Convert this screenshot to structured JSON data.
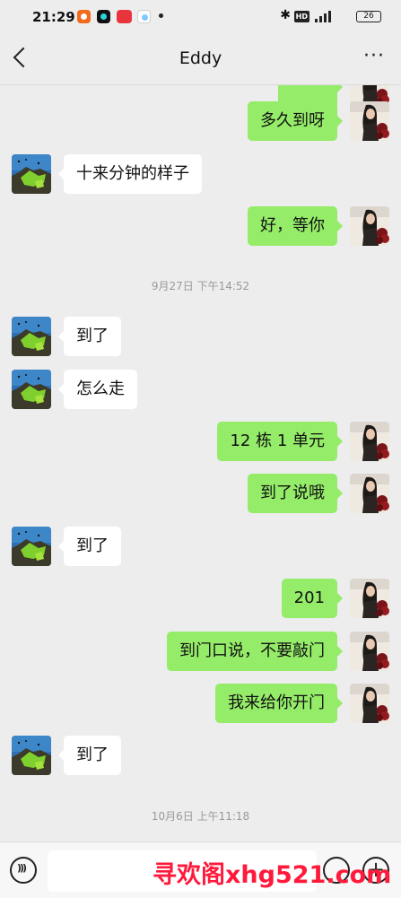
{
  "status_bar": {
    "time": "21:29",
    "battery": "26",
    "hd": "HD"
  },
  "header": {
    "title": "Eddy",
    "more": "···"
  },
  "messages": [
    {
      "side": "right",
      "text": "多久到呀"
    },
    {
      "side": "left",
      "text": "十来分钟的样子"
    },
    {
      "side": "right",
      "text": "好，等你"
    },
    {
      "side": "time",
      "text": "9月27日 下午14:52"
    },
    {
      "side": "left",
      "text": "到了"
    },
    {
      "side": "left",
      "text": "怎么走"
    },
    {
      "side": "right",
      "text": "12 栋 1 单元"
    },
    {
      "side": "right",
      "text": "到了说哦"
    },
    {
      "side": "left",
      "text": "到了"
    },
    {
      "side": "right",
      "text": "201"
    },
    {
      "side": "right",
      "text": "到门口说，不要敲门"
    },
    {
      "side": "right",
      "text": "我来给你开门"
    },
    {
      "side": "left",
      "text": "到了"
    },
    {
      "side": "time",
      "text": "10月6日 上午11:18"
    }
  ],
  "input_bar": {
    "placeholder": "",
    "add_icon": "+"
  },
  "watermark": "寻欢阁xhg521.com",
  "icons": {
    "back": "back-arrow-icon",
    "more": "more-dots-icon",
    "voice": "voice-icon",
    "emoji": "emoji-icon",
    "add": "add-icon"
  },
  "colors": {
    "background": "#ededed",
    "sent_bubble": "#95ec69",
    "received_bubble": "#ffffff",
    "watermark": "#ff1a3c"
  }
}
